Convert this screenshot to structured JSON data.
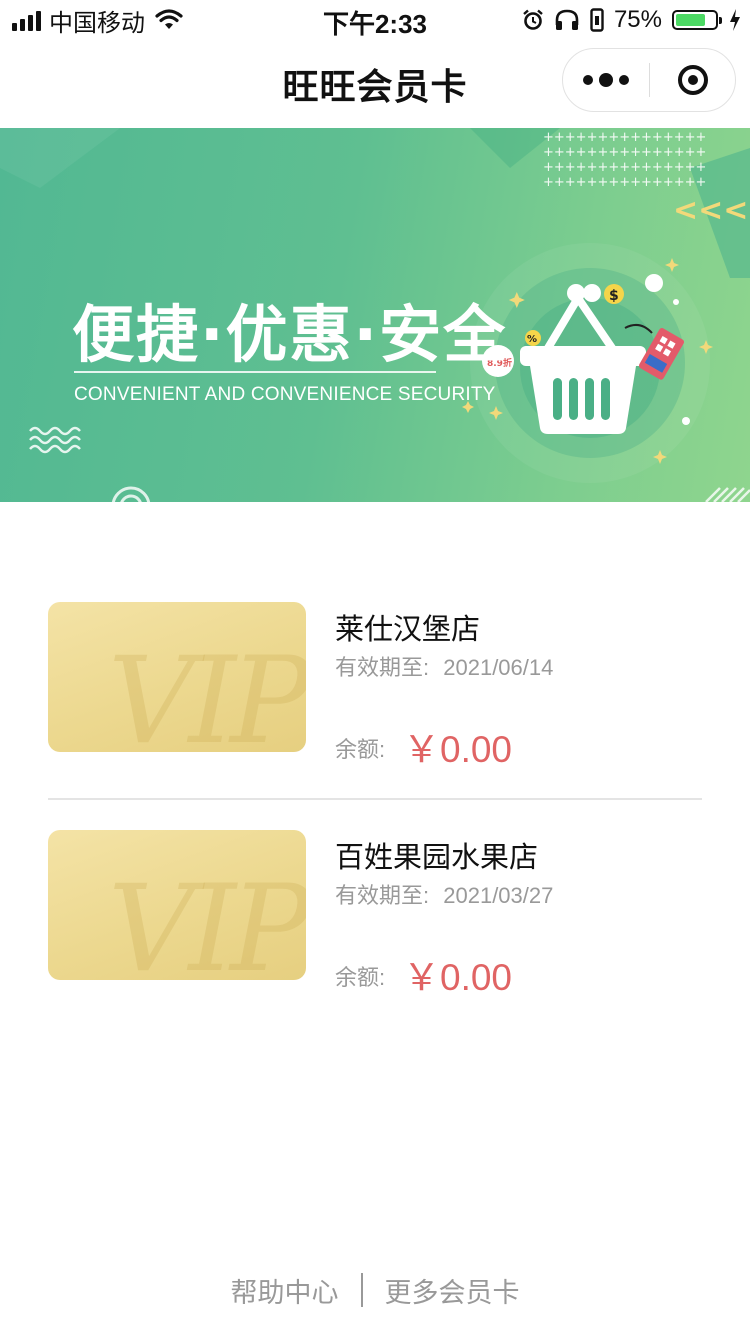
{
  "status_bar": {
    "carrier": "中国移动",
    "time": "下午2:33",
    "battery_percent_text": "75%",
    "battery_level": 0.75
  },
  "nav": {
    "title": "旺旺会员卡"
  },
  "banner": {
    "title": "便捷·优惠·安全",
    "subtitle": "CONVENIENT AND CONVENIENCE SECURITY",
    "discount_tag": "8.9折"
  },
  "cards": [
    {
      "vip_text": "VIP",
      "store_name": "莱仕汉堡店",
      "expiry_label": "有效期至:",
      "expiry_date": "2021/06/14",
      "balance_label": "余额:",
      "balance": "￥0.00"
    },
    {
      "vip_text": "VIP",
      "store_name": "百姓果园水果店",
      "expiry_label": "有效期至:",
      "expiry_date": "2021/03/27",
      "balance_label": "余额:",
      "balance": "￥0.00"
    }
  ],
  "footer": {
    "help": "帮助中心",
    "more_cards": "更多会员卡"
  },
  "colors": {
    "banner_green": "#5fbf91",
    "price_red": "#e06464",
    "card_gold": "#ecd88f",
    "muted_text": "#999999"
  }
}
